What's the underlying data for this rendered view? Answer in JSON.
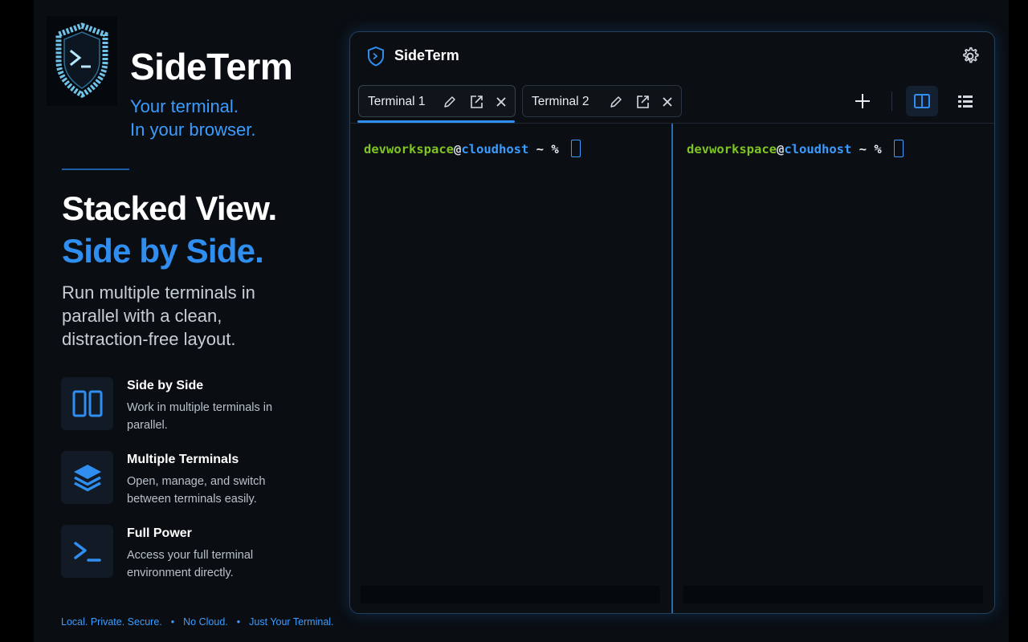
{
  "promo": {
    "brand": "SideTerm",
    "tagline_line1": "Your terminal.",
    "tagline_line2": "In your browser.",
    "hero_line1": "Stacked View.",
    "hero_line2": "Side by Side.",
    "hero_desc": "Run multiple terminals in parallel with a clean, distraction-free layout.",
    "features": [
      {
        "title": "Side by Side",
        "desc": "Work in multiple terminals in parallel.",
        "icon": "columns-icon"
      },
      {
        "title": "Multiple Terminals",
        "desc": "Open, manage, and switch between terminals easily.",
        "icon": "layers-icon"
      },
      {
        "title": "Full Power",
        "desc": "Access your full terminal environment directly.",
        "icon": "terminal-prompt-icon"
      }
    ],
    "footer": [
      "Local. Private. Secure.",
      "No Cloud.",
      "Just Your Terminal."
    ]
  },
  "app": {
    "title": "SideTerm",
    "tabs": [
      {
        "label": "Terminal 1",
        "active": true
      },
      {
        "label": "Terminal 2",
        "active": false
      }
    ],
    "panes": [
      {
        "user": "devworkspace",
        "at": "@",
        "host": "cloudhost",
        "tail": " ~ % "
      },
      {
        "user": "devworkspace",
        "at": "@",
        "host": "cloudhost",
        "tail": " ~ % "
      }
    ],
    "layout_mode": "side-by-side"
  },
  "colors": {
    "accent": "#2f8ef0",
    "prompt_user": "#7ec422",
    "prompt_host": "#3b9cff",
    "background": "#0a0e13"
  }
}
